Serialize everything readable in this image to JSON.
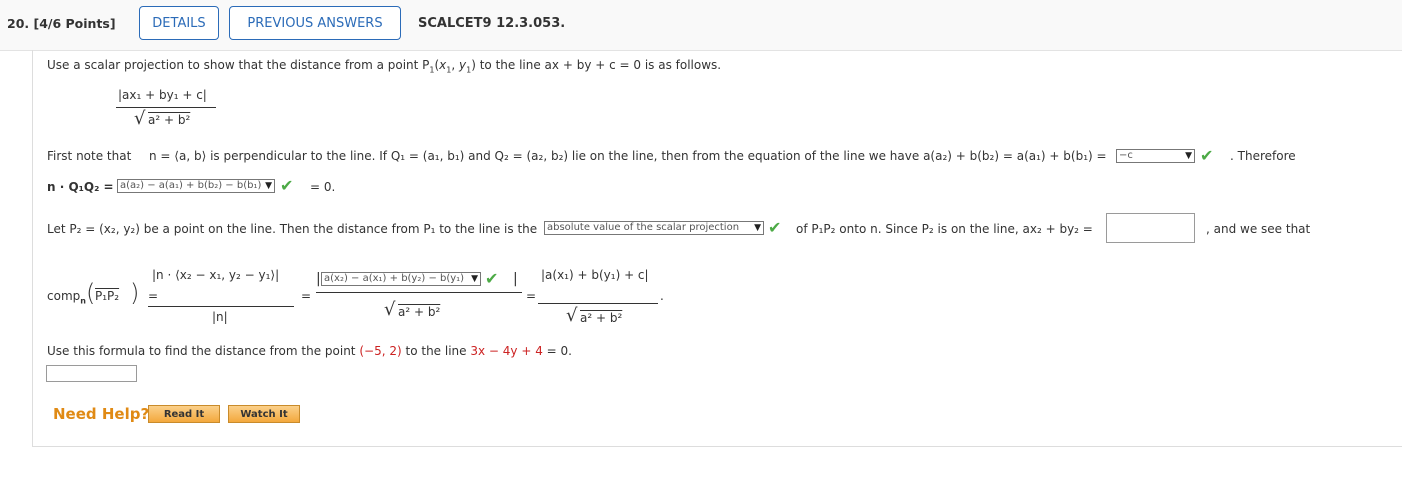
{
  "header": {
    "question": "20. [4/6 Points]",
    "details": "DETAILS",
    "previous_answers": "PREVIOUS ANSWERS",
    "code": "SCALCET9 12.3.053."
  },
  "intro": "Use a scalar projection to show that the distance from a point P",
  "intro_sub1": "1",
  "intro_tail": "to the line ax + by + c = 0 is as follows.",
  "formula": {
    "num": "|ax₁ + by₁ + c|",
    "den": "a² + b²"
  },
  "line1": {
    "text_a": "First note that",
    "text_b": "n = ⟨a, b⟩ is perpendicular to the line. If Q₁ = (a₁, b₁) and Q₂ = (a₂, b₂) lie on the line, then from the equation of the line we have a(a₂) + b(b₂) = a(a₁) + b(b₁) =",
    "select1": "−c",
    "therefore": ". Therefore"
  },
  "line2": {
    "lhs": "n · Q₁Q₂ =",
    "select2": "a(a₂) − a(a₁) + b(b₂) − b(b₁)",
    "rhs": "= 0."
  },
  "line3": {
    "text": "Let P₂ = (x₂, y₂) be a point on the line. Then the distance from P₁ to the line is the",
    "select3": "absolute value of the scalar projection",
    "text2": "of P₁P₂ onto n. Since P₂ is on the line, ax₂ + by₂ =",
    "text3": ", and we see that"
  },
  "comp": {
    "lhs": "comp",
    "lhs_sub": "n",
    "vec": "P₁P₂",
    "num1": "n · ⟨x₂ − x₁, y₂ − y₁⟩",
    "den1": "|n|",
    "select4": "a(x₂) − a(x₁) + b(y₂) − b(y₁)",
    "den2": "a² + b²",
    "num3": "a(x₁) + b(y₁) + c",
    "den3": "a² + b²"
  },
  "final": {
    "text": "Use this formula to find the distance from the point",
    "point": "(−5, 2)",
    "mid": "to the line",
    "line": "3x − 4y + 4",
    "end": "= 0."
  },
  "help": {
    "label": "Need Help?",
    "read": "Read It",
    "watch": "Watch It"
  }
}
